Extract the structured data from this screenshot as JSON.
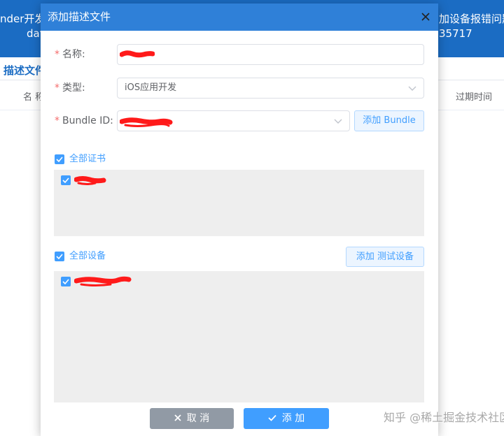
{
  "background": {
    "header_left_line1": "nder开发",
    "header_left_line2": "dat",
    "header_right_line1": "加设备报错问题",
    "header_right_line2": "35717",
    "tab_label": "描述文件",
    "table_headers": [
      "名 称",
      "过期时间"
    ]
  },
  "dialog": {
    "title": "添加描述文件",
    "fields": {
      "name": {
        "required_mark": "*",
        "label": "名称:",
        "value": ""
      },
      "type": {
        "required_mark": "*",
        "label": "类型:",
        "value": "iOS应用开发"
      },
      "bundle_id": {
        "required_mark": "*",
        "label": "Bundle ID:",
        "value": ""
      }
    },
    "add_bundle_button": "添加 Bundle",
    "certificates": {
      "select_all_label": "全部证书",
      "select_all_checked": true,
      "items": [
        {
          "checked": true
        }
      ]
    },
    "devices": {
      "select_all_label": "全部设备",
      "select_all_checked": true,
      "add_button": "添加 测试设备",
      "items": [
        {
          "checked": true
        }
      ]
    },
    "footer": {
      "cancel_label": "取 消",
      "confirm_label": "添 加"
    }
  },
  "watermark": "知乎 @稀土掘金技术社区",
  "icons": {
    "close": "close-icon",
    "select_arrow": "chevron-down-icon",
    "checkbox": "check-icon",
    "cancel": "x-icon",
    "confirm": "check-icon"
  },
  "colors": {
    "page_header": "#1b6cc3",
    "dialog_header": "#2f80d8",
    "primary": "#409eff",
    "required": "#f56c6c",
    "cancel_button": "#919aa5",
    "list_background": "#eeeeee",
    "redaction": "#ff1a1a"
  }
}
